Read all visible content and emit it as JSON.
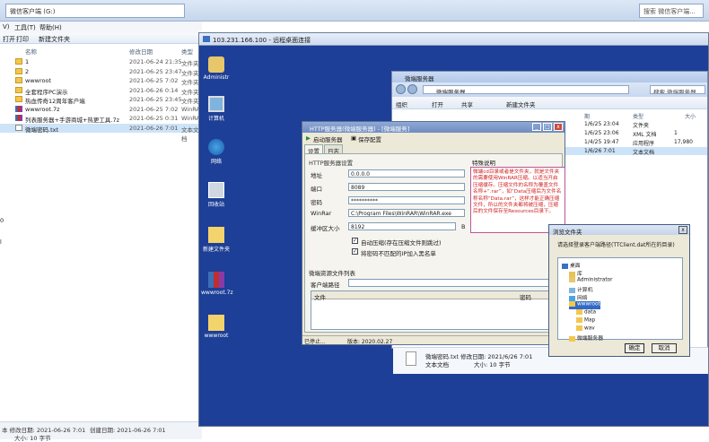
{
  "explorer": {
    "breadcrumb": "微信客户端 (G:)",
    "search": "搜索 微信客户端...",
    "menu": [
      "V)",
      "工具(T)",
      "帮助(H)"
    ],
    "toolbar": [
      "打开",
      "打印",
      "新建文件夹"
    ],
    "columns": [
      "名称",
      "修改日期",
      "类型"
    ],
    "files": [
      {
        "name": "1",
        "date": "2021-06-24 21:35",
        "type": "文件夹",
        "icon": "folder-icon"
      },
      {
        "name": "2",
        "date": "2021-06-25 23:47",
        "type": "文件夹",
        "icon": "folder-icon"
      },
      {
        "name": "wwwroot",
        "date": "2021-06-25 7:02",
        "type": "文件夹",
        "icon": "folder-icon"
      },
      {
        "name": "全套程序PC演示",
        "date": "2021-06-26 0:14",
        "type": "文件夹",
        "icon": "folder-icon"
      },
      {
        "name": "热血传奇12周年客户端",
        "date": "2021-06-25 23:45",
        "type": "文件夹",
        "icon": "folder-icon"
      },
      {
        "name": "wwwroot.7z",
        "date": "2021-06-25 7:02",
        "type": "WinRAR",
        "icon": "archive-icon"
      },
      {
        "name": "列表服务器+手游商城+热更工具.7z",
        "date": "2021-06-25 0:31",
        "type": "WinRAR",
        "icon": "archive-icon"
      },
      {
        "name": "微端密码.txt",
        "date": "2021-06-26 7:01",
        "type": "文本文档",
        "icon": "text-file-icon"
      }
    ],
    "left_edge_text": [
      "0",
      "l"
    ],
    "status": {
      "modified": "本 修改日期: 2021-06-26 7:01",
      "created": "创建日期: 2021-06-26 7:01",
      "size": "大小: 10 字节"
    }
  },
  "remote": {
    "title": "103.231.166.100 - 远程桌面连接",
    "desktop_icons": [
      "Administr",
      "计算机",
      "网络",
      "回收站",
      "新建文件夹",
      "wwwroot.7z",
      "wwwroot"
    ],
    "inner_explorer": {
      "title": "微端服务器",
      "path": "微端服务器",
      "search": "搜索 微端服务器",
      "toolbar": [
        "组织",
        "打开",
        "共享",
        "新建文件夹"
      ],
      "columns": [
        "期",
        "类型",
        "大小"
      ],
      "rows": [
        {
          "date": "1/6/25 23:04",
          "type": "文件夹"
        },
        {
          "date": "1/6/25 23:06",
          "type": "XML 文档",
          "size": "1"
        },
        {
          "date": "1/4/25 19:47",
          "type": "应用程序",
          "size": "17,980"
        },
        {
          "date": "1/6/26 7:01",
          "type": "文本文档"
        }
      ]
    },
    "http_dialog": {
      "title": "HTTP服务器(微端服务器) - [微端服务]",
      "toolbar": [
        "启动服务器",
        "保存配置"
      ],
      "tabs": [
        "设置",
        "日志"
      ],
      "section": "HTTP服务器设置",
      "fields": [
        {
          "label": "地址",
          "value": "0.0.0.0"
        },
        {
          "label": "端口",
          "value": "8089"
        },
        {
          "label": "密码",
          "value": "**********"
        },
        {
          "label": "WinRar",
          "value": "C:\\Program Files\\WinRAR\\WinRAR.exe"
        },
        {
          "label": "缓冲区大小",
          "value": "8192",
          "suffix": "B"
        }
      ],
      "note_title": "特殊说明",
      "note": "微端cd目录或者是文件夹，就是文件夹的需要使用WinRAR压缩。以适当开启压缩缓存。压缩文件的名称为覆盖文件名称+“.rar”，如“Data压缩后为文件名称名称“Data.rar”，这样才能正确压缩文件，所以的文件夹都将被压缩，压缩后的文件保存至Resources目录下。",
      "checks": [
        {
          "label": "自动压缩(存在压缩文件则跳过)",
          "checked": true
        },
        {
          "label": "将密码不匹配的IP加入黑名单",
          "checked": true
        }
      ],
      "list_title": "微端资源文件列表",
      "client_path_label": "客户端路径",
      "list_columns": [
        "文件",
        "密码"
      ],
      "status": [
        "已停止...",
        "版本: 2020.02.27"
      ]
    },
    "browse_dialog": {
      "title": "浏览文件夹",
      "prompt": "请选择登录客户端路径(TTClient.dat所在的目录)",
      "tree": [
        {
          "label": "桌面",
          "indent": 0,
          "icon": "desktop-icon"
        },
        {
          "label": "库",
          "indent": 1,
          "icon": "library-icon"
        },
        {
          "label": "Administrator",
          "indent": 1,
          "icon": "user-icon"
        },
        {
          "label": "计算机",
          "indent": 1,
          "icon": "computer-icon"
        },
        {
          "label": "网络",
          "indent": 1,
          "icon": "network-icon"
        },
        {
          "label": "wwwroot",
          "indent": 1,
          "icon": "folder-icon",
          "selected": true
        },
        {
          "label": "data",
          "indent": 2,
          "icon": "folder-icon"
        },
        {
          "label": "Map",
          "indent": 2,
          "icon": "folder-icon"
        },
        {
          "label": "wav",
          "indent": 2,
          "icon": "folder-icon"
        },
        {
          "label": "微端服务器",
          "indent": 1,
          "icon": "folder-icon"
        }
      ],
      "ok": "确定",
      "cancel": "取消"
    },
    "file_info": {
      "name": "微端密码.txt 修改日期: 2021/6/26 7:01",
      "type": "文本文档",
      "size": "大小: 10 字节"
    }
  }
}
